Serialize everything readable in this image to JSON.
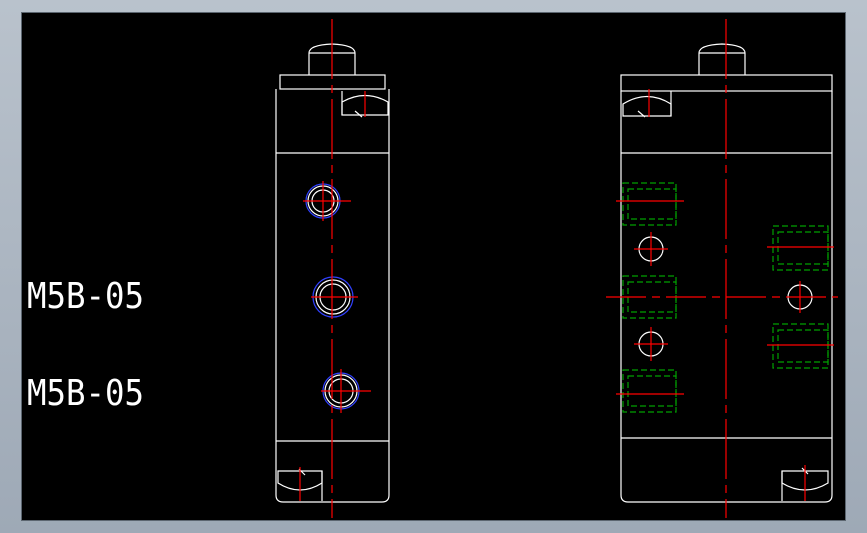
{
  "colors": {
    "background": "#000000",
    "outline": "#ffffff",
    "centerline": "#ff0000",
    "hidden_line": "#00a000",
    "seal": "#3040ff"
  },
  "labels": {
    "part_code_upper": "M5B-05",
    "part_code_lower": "M5B-05"
  }
}
